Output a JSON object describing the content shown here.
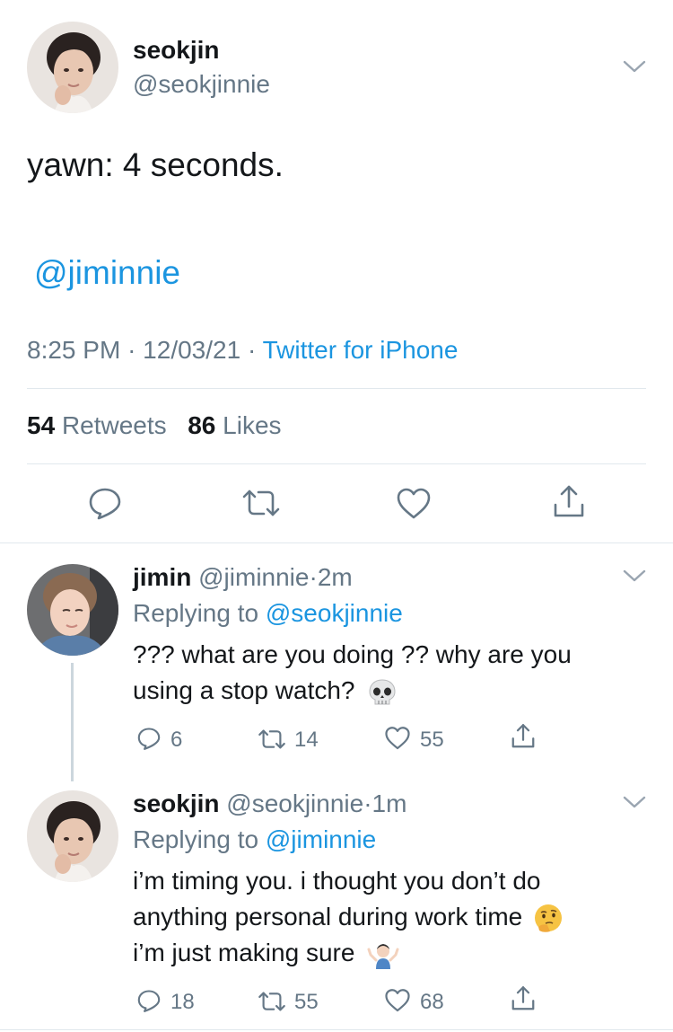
{
  "main_tweet": {
    "display_name": "seokjin",
    "handle": "@seokjinnie",
    "text": "yawn: 4 seconds.",
    "mention": "@jiminnie",
    "time": "8:25 PM",
    "date": "12/03/21",
    "separator": "·",
    "source": "Twitter for iPhone",
    "retweets_count": "54",
    "retweets_label": "Retweets",
    "likes_count": "86",
    "likes_label": "Likes"
  },
  "replies": [
    {
      "display_name": "jimin",
      "handle": "@jiminnie",
      "dot": "·",
      "age": "2m",
      "replying_label": "Replying to",
      "replying_to": "@seokjinnie",
      "line1": "??? what are you doing ?? why are you",
      "line2": "using a stop watch?",
      "emoji": "skull-emoji",
      "reply_count": "6",
      "retweet_count": "14",
      "like_count": "55"
    },
    {
      "display_name": "seokjin",
      "handle": "@seokjinnie",
      "dot": "·",
      "age": "1m",
      "replying_label": "Replying to",
      "replying_to": "@jiminnie",
      "line1": "i’m timing you. i thought you don’t do",
      "line2": "anything personal during work time",
      "line3": "i’m just making sure",
      "emoji1": "thinking-face-emoji",
      "emoji2": "person-shrugging-emoji",
      "reply_count": "18",
      "retweet_count": "55",
      "like_count": "68"
    }
  ],
  "colors": {
    "link": "#1b95e0",
    "muted": "#657786",
    "divider": "#e1e8ed",
    "icon": "#657786"
  }
}
